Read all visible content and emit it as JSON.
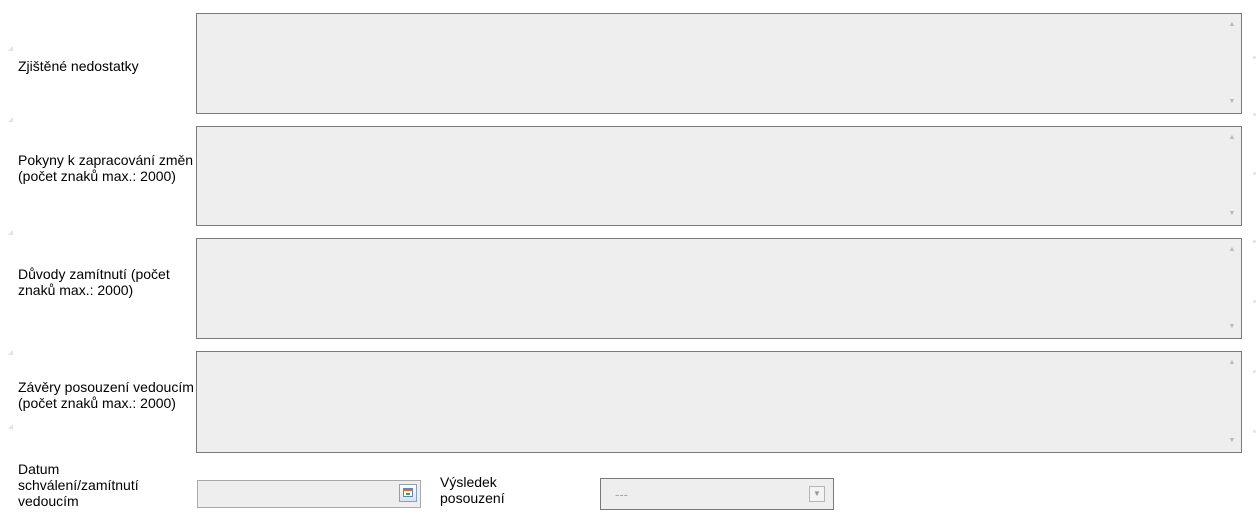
{
  "fields": {
    "nedostatky": {
      "label": "Zjištěné nedostatky",
      "value": ""
    },
    "pokyny": {
      "label": "Pokyny k zapracování změn (počet znaků max.: 2000)",
      "value": ""
    },
    "duvody": {
      "label": "Důvody zamítnutí (počet znaků max.: 2000)",
      "value": ""
    },
    "zavery": {
      "label": "Závěry posouzení vedoucím (počet znaků max.: 2000)",
      "value": ""
    },
    "datum": {
      "label": "Datum schválení/zamítnutí vedoucím",
      "value": ""
    },
    "vysledek": {
      "label": "Výsledek posouzení",
      "selected": "---"
    }
  },
  "icons": {
    "calendar": "calendar-icon",
    "dropdown": "chevron-down-icon",
    "scroll_up": "scroll-up-arrow",
    "scroll_down": "scroll-down-arrow"
  },
  "colors": {
    "field_bg": "#eeeeee",
    "field_border": "#7a7a7a",
    "placeholder_text": "#a8a8a8"
  }
}
